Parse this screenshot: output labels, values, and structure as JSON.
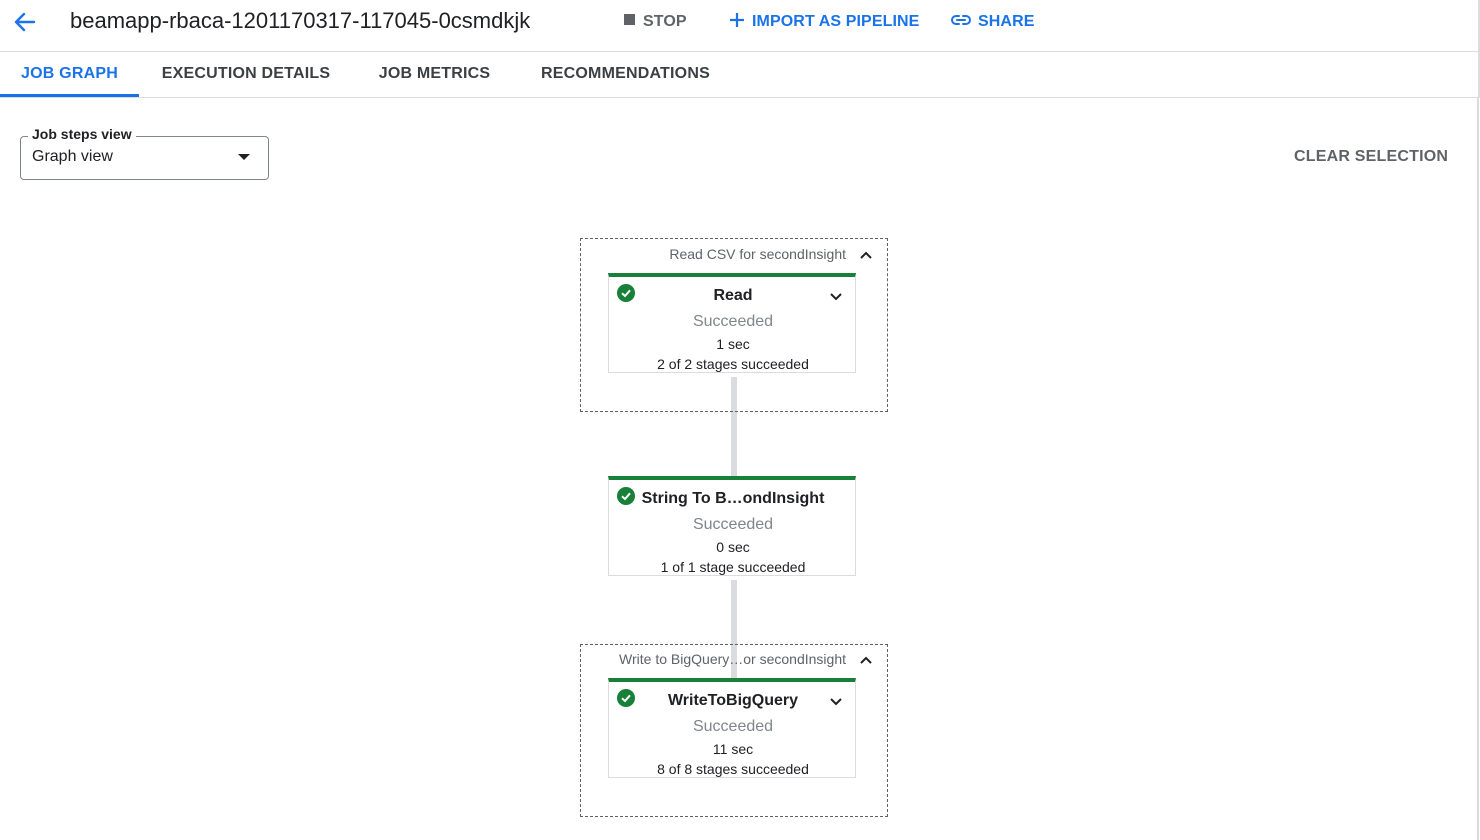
{
  "header": {
    "job_title": "beamapp-rbaca-1201170317-117045-0csmdkjk",
    "stop_label": "STOP",
    "import_label": "IMPORT AS PIPELINE",
    "share_label": "SHARE"
  },
  "tabs": [
    {
      "label": "JOB GRAPH",
      "active": true
    },
    {
      "label": "EXECUTION DETAILS",
      "active": false
    },
    {
      "label": "JOB METRICS",
      "active": false
    },
    {
      "label": "RECOMMENDATIONS",
      "active": false
    }
  ],
  "steps_view": {
    "label": "Job steps view",
    "value": "Graph view"
  },
  "clear_selection_label": "CLEAR SELECTION",
  "graph": {
    "groups": [
      {
        "title": "Read CSV for secondInsight"
      },
      {
        "title": "Write to BigQuery…or secondInsight"
      }
    ],
    "nodes": [
      {
        "name": "Read",
        "status": "Succeeded",
        "duration": "1 sec",
        "stages": "2 of 2 stages succeeded"
      },
      {
        "name": "String To B…ondInsight",
        "status": "Succeeded",
        "duration": "0 sec",
        "stages": "1 of 1 stage succeeded"
      },
      {
        "name": "WriteToBigQuery",
        "status": "Succeeded",
        "duration": "11 sec",
        "stages": "8 of 8 stages succeeded"
      }
    ]
  },
  "colors": {
    "accent": "#1a73e8",
    "success": "#188038",
    "muted": "#5f6368"
  }
}
